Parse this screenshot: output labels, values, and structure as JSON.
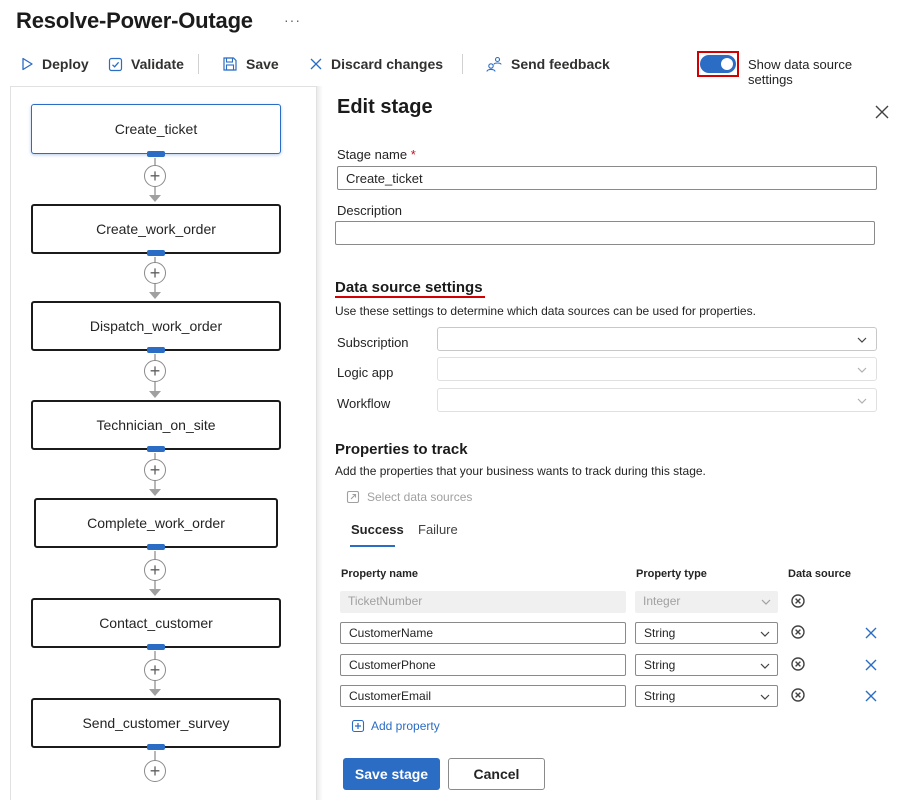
{
  "header": {
    "title": "Resolve-Power-Outage",
    "more": "···"
  },
  "toolbar": {
    "deploy": "Deploy",
    "validate": "Validate",
    "save": "Save",
    "discard": "Discard changes",
    "feedback": "Send feedback",
    "toggle_label": "Show data source settings",
    "toggle_on": true
  },
  "canvas": {
    "stages": [
      {
        "label": "Create_ticket",
        "selected": true
      },
      {
        "label": "Create_work_order",
        "selected": false
      },
      {
        "label": "Dispatch_work_order",
        "selected": false
      },
      {
        "label": "Technician_on_site",
        "selected": false
      },
      {
        "label": "Complete_work_order",
        "selected": false
      },
      {
        "label": "Contact_customer",
        "selected": false
      },
      {
        "label": "Send_customer_survey",
        "selected": false
      }
    ]
  },
  "panel": {
    "title": "Edit stage",
    "stage_name_label": "Stage name",
    "required_mark": "*",
    "stage_name_value": "Create_ticket",
    "description_label": "Description",
    "description_value": "",
    "data_source": {
      "title": "Data source settings",
      "hint": "Use these settings to determine which data sources can be used for properties.",
      "subscription_label": "Subscription",
      "logic_app_label": "Logic app",
      "workflow_label": "Workflow"
    },
    "properties": {
      "title": "Properties to track",
      "hint": "Add the properties that your business wants to track during this stage.",
      "select_sources": "Select data sources",
      "tabs": [
        "Success",
        "Failure"
      ],
      "active_tab": "Success",
      "col_name": "Property name",
      "col_type": "Property type",
      "col_source": "Data source",
      "rows": [
        {
          "name": "TicketNumber",
          "type": "Integer",
          "disabled": true
        },
        {
          "name": "CustomerName",
          "type": "String",
          "disabled": false
        },
        {
          "name": "CustomerPhone",
          "type": "String",
          "disabled": false
        },
        {
          "name": "CustomerEmail",
          "type": "String",
          "disabled": false
        }
      ],
      "add_property": "Add property"
    },
    "save_button": "Save stage",
    "cancel_button": "Cancel"
  },
  "colors": {
    "accent": "#2b6cc4",
    "highlight": "#d20000"
  }
}
